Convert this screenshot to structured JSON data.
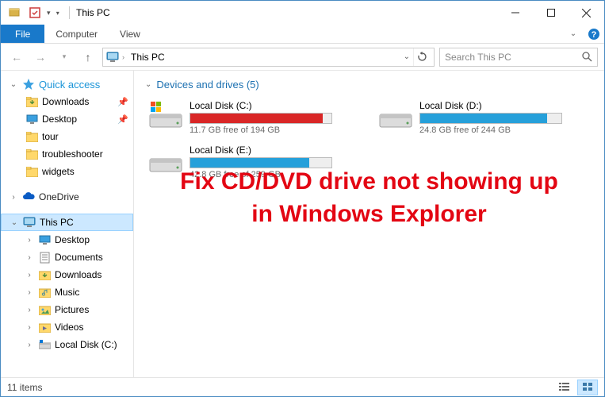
{
  "window": {
    "title": "This PC"
  },
  "ribbon": {
    "file": "File",
    "computer": "Computer",
    "view": "View"
  },
  "addressbar": {
    "location": "This PC"
  },
  "search": {
    "placeholder": "Search This PC"
  },
  "nav": {
    "quick_access": "Quick access",
    "downloads": "Downloads",
    "desktop": "Desktop",
    "tour": "tour",
    "troubleshooter": "troubleshooter",
    "widgets": "widgets",
    "onedrive": "OneDrive",
    "this_pc": "This PC",
    "pc_desktop": "Desktop",
    "pc_documents": "Documents",
    "pc_downloads": "Downloads",
    "pc_music": "Music",
    "pc_pictures": "Pictures",
    "pc_videos": "Videos",
    "pc_localc": "Local Disk (C:)"
  },
  "section": {
    "heading": "Devices and drives (5)"
  },
  "drives": {
    "c": {
      "name": "Local Disk (C:)",
      "free": "11.7 GB free of 194 GB",
      "fill_pct": 94,
      "color": "red",
      "os": true
    },
    "d": {
      "name": "Local Disk (D:)",
      "free": "24.8 GB free of 244 GB",
      "fill_pct": 90,
      "color": "blue",
      "os": false
    },
    "e": {
      "name": "Local Disk (E:)",
      "free": "42.8 GB free of 259 GB",
      "fill_pct": 84,
      "color": "blue",
      "os": false
    }
  },
  "overlay": {
    "line1": "Fix CD/DVD drive not showing up",
    "line2": "in Windows Explorer"
  },
  "status": {
    "count": "11 items"
  }
}
